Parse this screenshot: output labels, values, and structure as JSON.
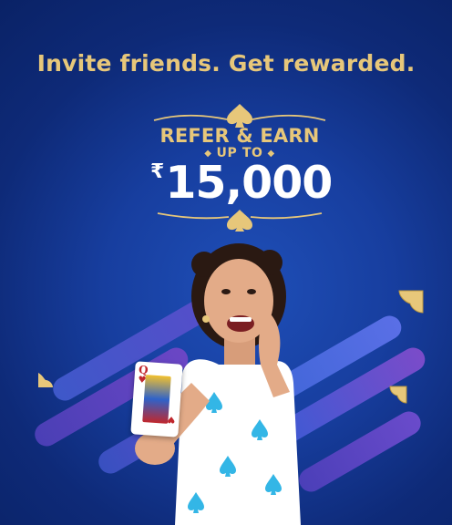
{
  "headline": "Invite friends. Get rewarded.",
  "badge": {
    "refer_text": "REFER & EARN",
    "upto_text": "UP TO",
    "currency_symbol": "₹",
    "amount": "15,000"
  },
  "card": {
    "rank": "Q"
  },
  "colors": {
    "gold": "#e7c77a",
    "background_blue": "#173e9f",
    "stripe_blue": "#3b5fd8",
    "stripe_purple": "#7b4bc9",
    "dress_blue": "#33b6e6"
  },
  "icons": [
    "spade-icon",
    "spade-icon",
    "spade-icon",
    "spade-icon",
    "spade-icon"
  ]
}
